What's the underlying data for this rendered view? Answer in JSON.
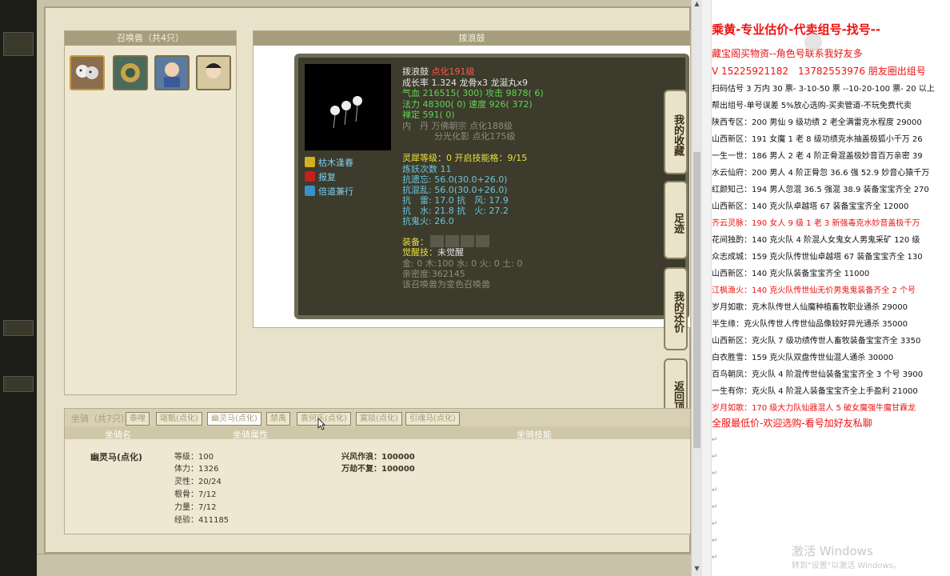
{
  "summon_list": {
    "title": "召唤兽（共4只）"
  },
  "detail": {
    "title": "拨浪鼓"
  },
  "tooltip": {
    "line1_name": "拨浪鼓",
    "line1_tag": "点化191级",
    "line2": "成长率 1.324 龙骨x3 龙涎丸x9",
    "line3_a": "气血 216515( 300) 攻击 9878( 6)",
    "line4": "法力 48300( 0) 速度 926( 372)",
    "line5": "禅定 591( 0)",
    "line6": "内　丹 万佛朝宗 点化188级",
    "line7": "分光化影 点化175级",
    "line8": "灵犀等级：0 开启技能格：9/15",
    "line9": "炼妖次数 11",
    "line10": "抗遗忘: 56.0(30.0+26.0)",
    "line11": "抗混乱: 56.0(30.0+26.0)",
    "line12": "抗　雷: 17.0 抗　风: 17.9",
    "line13": "抗　水: 21.8 抗　火: 27.2",
    "line14": "抗鬼火: 26.0",
    "equip_label": "装备：",
    "awaken_label": "觉醒技：",
    "awaken_value": "未觉醒",
    "line17": "金: 0 木:100 水: 0 火: 0 土: 0",
    "line18": "亲密度:362145",
    "line19": "该召唤兽为变色召唤兽",
    "skills": [
      "枯木逢春",
      "报复",
      "倍道兼行"
    ]
  },
  "side_tabs": [
    "我的收藏",
    "足迹",
    "我的还价",
    "返回顶部"
  ],
  "mount": {
    "count_label": "坐骑（共7只）",
    "tabs": [
      "泰哩",
      "堪甄(点化)",
      "幽灵马(点化)",
      "禁禹",
      "袁何乐(点化)",
      "寞琰(点化)",
      "引魂马(点化)"
    ],
    "columns": [
      "坐骑名",
      "坐骑属性",
      "坐骑技能"
    ],
    "name": "幽灵马(点化)",
    "attrs": [
      "等级：100",
      "体力：1326",
      "灵性：20/24",
      "根骨：7/12",
      "力量：7/12",
      "经验：411185"
    ],
    "skills": [
      "兴风作浪：100000",
      "万劫不复：100000"
    ]
  },
  "doc": {
    "title": "乘黄-专业估价-代卖组号-找号--",
    "line2": "藏宝阁买物资--角色号联系我好友多",
    "line3": "V 15225921182　13782553976 朋友圈出组号",
    "line4": "扫码估号 3 万内 30 票- 3-10-50 票 --10-20-100 票- 20 以上",
    "line5": "帮出组号-单号误差 5%放心选购-买卖管道-不玩免费代卖",
    "rows": [
      {
        "t": "陕西专区：200 男仙 9 级功绩 2 老全满雷克水程度 29000",
        "red": false
      },
      {
        "t": "山西新区：191 女魔 1 老 8 级功绩克水抽盖极狐小千万 26",
        "red": false
      },
      {
        "t": "一生一世：186 男人 2 老 4 阶正骨混盖极妙音百万亲密 39",
        "red": false
      },
      {
        "t": "水云仙府：200 男人 4 阶正骨忽 36.6 强 52.9 妙音心猿千万",
        "red": false
      },
      {
        "t": "红颜知己：194 男人忽混 36.5 强混 38.9 装备宝宝齐全 270",
        "red": false
      },
      {
        "t": "山西新区：140 克火队卓越塔 67 装备宝宝齐全 12000",
        "red": false
      },
      {
        "t": "齐云灵脉：190 女人 9 级 1 老 3 新强毒克水妙音盖极千万",
        "red": true
      },
      {
        "t": "花间独酌：140 克火队 4 阶混人女鬼女人男鬼采矿 120 级",
        "red": false
      },
      {
        "t": "众志成城：159 克火队传世仙卓越塔 67 装备宝宝齐全 130",
        "red": false
      },
      {
        "t": "山西新区：140 克火队装备宝宝齐全 11000",
        "red": false
      },
      {
        "t": "江枫渔火：140 克火队传世仙无价男鬼鬼装备齐全 2 个号",
        "red": true
      },
      {
        "t": "岁月如歌：克木队传世人仙魔种植畜牧职业通杀 29000",
        "red": false
      },
      {
        "t": "半生缘：克火队传世人传世仙品像较好异光通杀 35000",
        "red": false
      },
      {
        "t": "山西新区：克火队 7 级功绩传世人畜牧装备宝宝齐全 3350",
        "red": false
      },
      {
        "t": "白衣胜雪：159 克火队双盘传世仙混人通杀 30000",
        "red": false
      },
      {
        "t": "百鸟朝凤：克火队 4 阶混传世仙装备宝宝齐全 3 个号 3900",
        "red": false
      },
      {
        "t": "一生有你：克火队 4 阶混人装备宝宝齐全上手盈利 21000",
        "red": false
      },
      {
        "t": "岁月如歌：170 级大力队仙器混人 5 破女魔强牛魔甘霖龙",
        "red": true
      },
      {
        "t": "全服最低价-欢迎选购-看号加好友私聊",
        "red": true
      }
    ],
    "watermark_1": "激活 Windows",
    "watermark_2": "转到\"设置\"以激活 Windows。"
  }
}
